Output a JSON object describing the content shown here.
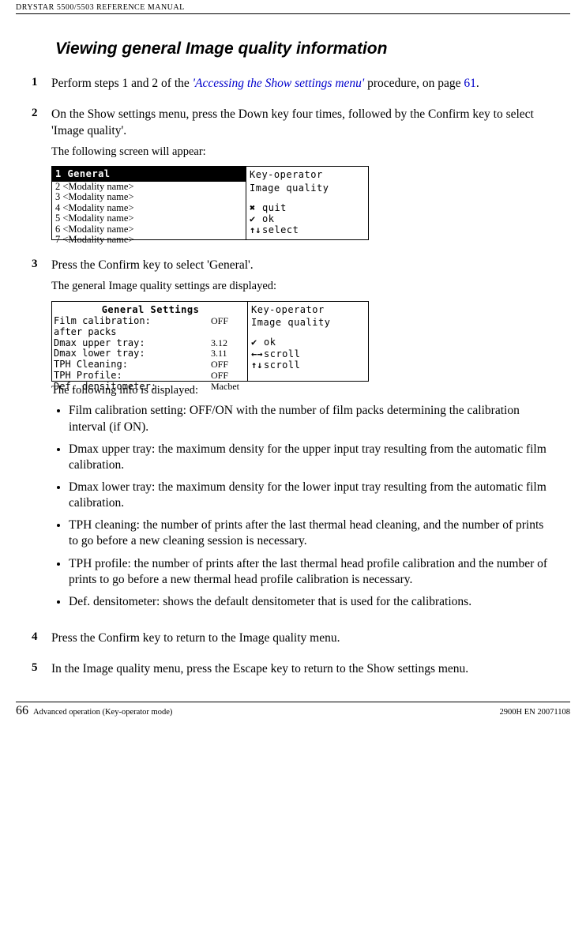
{
  "running_header": "DRYSTAR 5500/5503 REFERENCE MANUAL",
  "section_title": "Viewing general Image quality information",
  "step1": {
    "num": "1",
    "text_pre": "Perform steps 1 and 2 of the ",
    "link": "'Accessing the Show settings menu'",
    "text_mid": " procedure, on page ",
    "page_link": "61",
    "text_end": "."
  },
  "step2": {
    "num": "2",
    "text": "On the Show settings menu, press the Down key four times, followed by the Confirm key to select 'Image quality'.",
    "note": "The following screen will appear:"
  },
  "screen1": {
    "selected": "1 General",
    "rows": [
      "2 <Modality name>",
      "3 <Modality name>",
      "4 <Modality name>",
      "5 <Modality name>",
      "6 <Modality name>",
      "7 <Modality name>"
    ],
    "right_header1": "Key-operator",
    "right_header2": "Image quality",
    "icons": [
      {
        "glyph": "✖",
        "label": "quit"
      },
      {
        "glyph": "✔",
        "label": "ok"
      },
      {
        "glyph": "↑↓",
        "label": "select"
      }
    ]
  },
  "step3": {
    "num": "3",
    "text": "Press the Confirm key to select 'General'.",
    "note": "The general Image quality settings are displayed:"
  },
  "screen2": {
    "title": "General Settings",
    "rows": [
      {
        "label": "Film calibration:",
        "val": "OFF"
      },
      {
        "label": " after  packs",
        "val": ""
      },
      {
        "label": "Dmax upper tray:",
        "val": "3.12"
      },
      {
        "label": "Dmax lower tray:",
        "val": "3.11"
      },
      {
        "label": "TPH Cleaning:",
        "val": "OFF"
      },
      {
        "label": "TPH Profile:",
        "val": "OFF"
      },
      {
        "label": "Def. densitometer:",
        "val": "Macbet"
      }
    ],
    "right_header1": "Key-operator",
    "right_header2": "Image quality",
    "icons": [
      {
        "glyph": "✔",
        "label": "ok"
      },
      {
        "glyph": "←→",
        "label": "scroll"
      },
      {
        "glyph": "↑↓",
        "label": "scroll"
      }
    ]
  },
  "info_line": "The following info is displayed:",
  "bullets": [
    "Film calibration setting: OFF/ON with the number of film packs determining the calibration interval (if ON).",
    "Dmax upper tray: the maximum density for the upper input tray resulting from the automatic film calibration.",
    "Dmax lower tray: the maximum density for the lower input tray resulting from the automatic film calibration.",
    "TPH cleaning: the number of prints after the last thermal head cleaning, and the number of prints to go before a new cleaning session is necessary.",
    "TPH profile: the number of prints after the last thermal head profile calibration and the number of prints to go before a new thermal head profile calibration is necessary.",
    "Def. densitometer: shows the default densitometer that is used for the calibrations."
  ],
  "step4": {
    "num": "4",
    "text": "Press the Confirm key to return to the Image quality menu."
  },
  "step5": {
    "num": "5",
    "text": "In the Image quality menu, press the Escape key to return to the Show settings menu."
  },
  "footer": {
    "page_num": "66",
    "left": "Advanced operation (Key-operator mode)",
    "right": "2900H EN 20071108"
  }
}
